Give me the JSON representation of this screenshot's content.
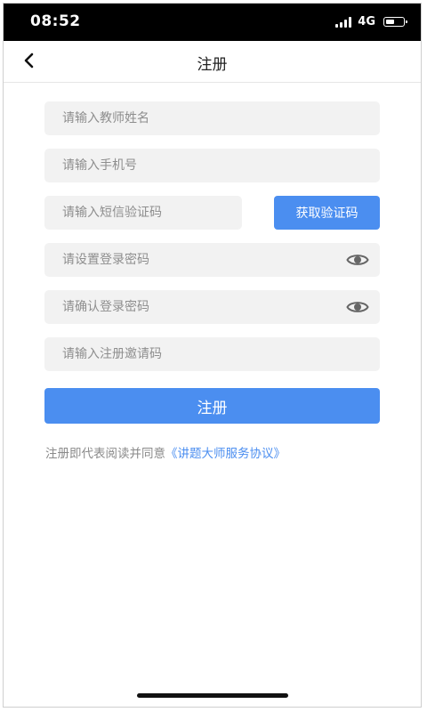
{
  "status_bar": {
    "time": "08:52",
    "network": "4G",
    "battery_level": 0.55,
    "signal_bars": 4
  },
  "nav": {
    "title": "注册",
    "back_icon": "chevron-left-icon"
  },
  "form": {
    "teacher_name": {
      "placeholder": "请输入教师姓名",
      "value": ""
    },
    "phone": {
      "placeholder": "请输入手机号",
      "value": ""
    },
    "sms_code": {
      "placeholder": "请输入短信验证码",
      "value": ""
    },
    "get_code_label": "获取验证码",
    "password": {
      "placeholder": "请设置登录密码",
      "value": "",
      "icon": "eye-icon"
    },
    "confirm_password": {
      "placeholder": "请确认登录密码",
      "value": "",
      "icon": "eye-icon"
    },
    "invite_code": {
      "placeholder": "请输入注册邀请码",
      "value": ""
    },
    "submit_label": "注册"
  },
  "agreement": {
    "prefix": "注册即代表阅读并同意",
    "link": "《讲题大师服务协议》"
  },
  "colors": {
    "accent": "#4b8ef0",
    "field_bg": "#f2f2f2",
    "placeholder": "#8e8e8e",
    "status_bar_bg": "#000000"
  }
}
